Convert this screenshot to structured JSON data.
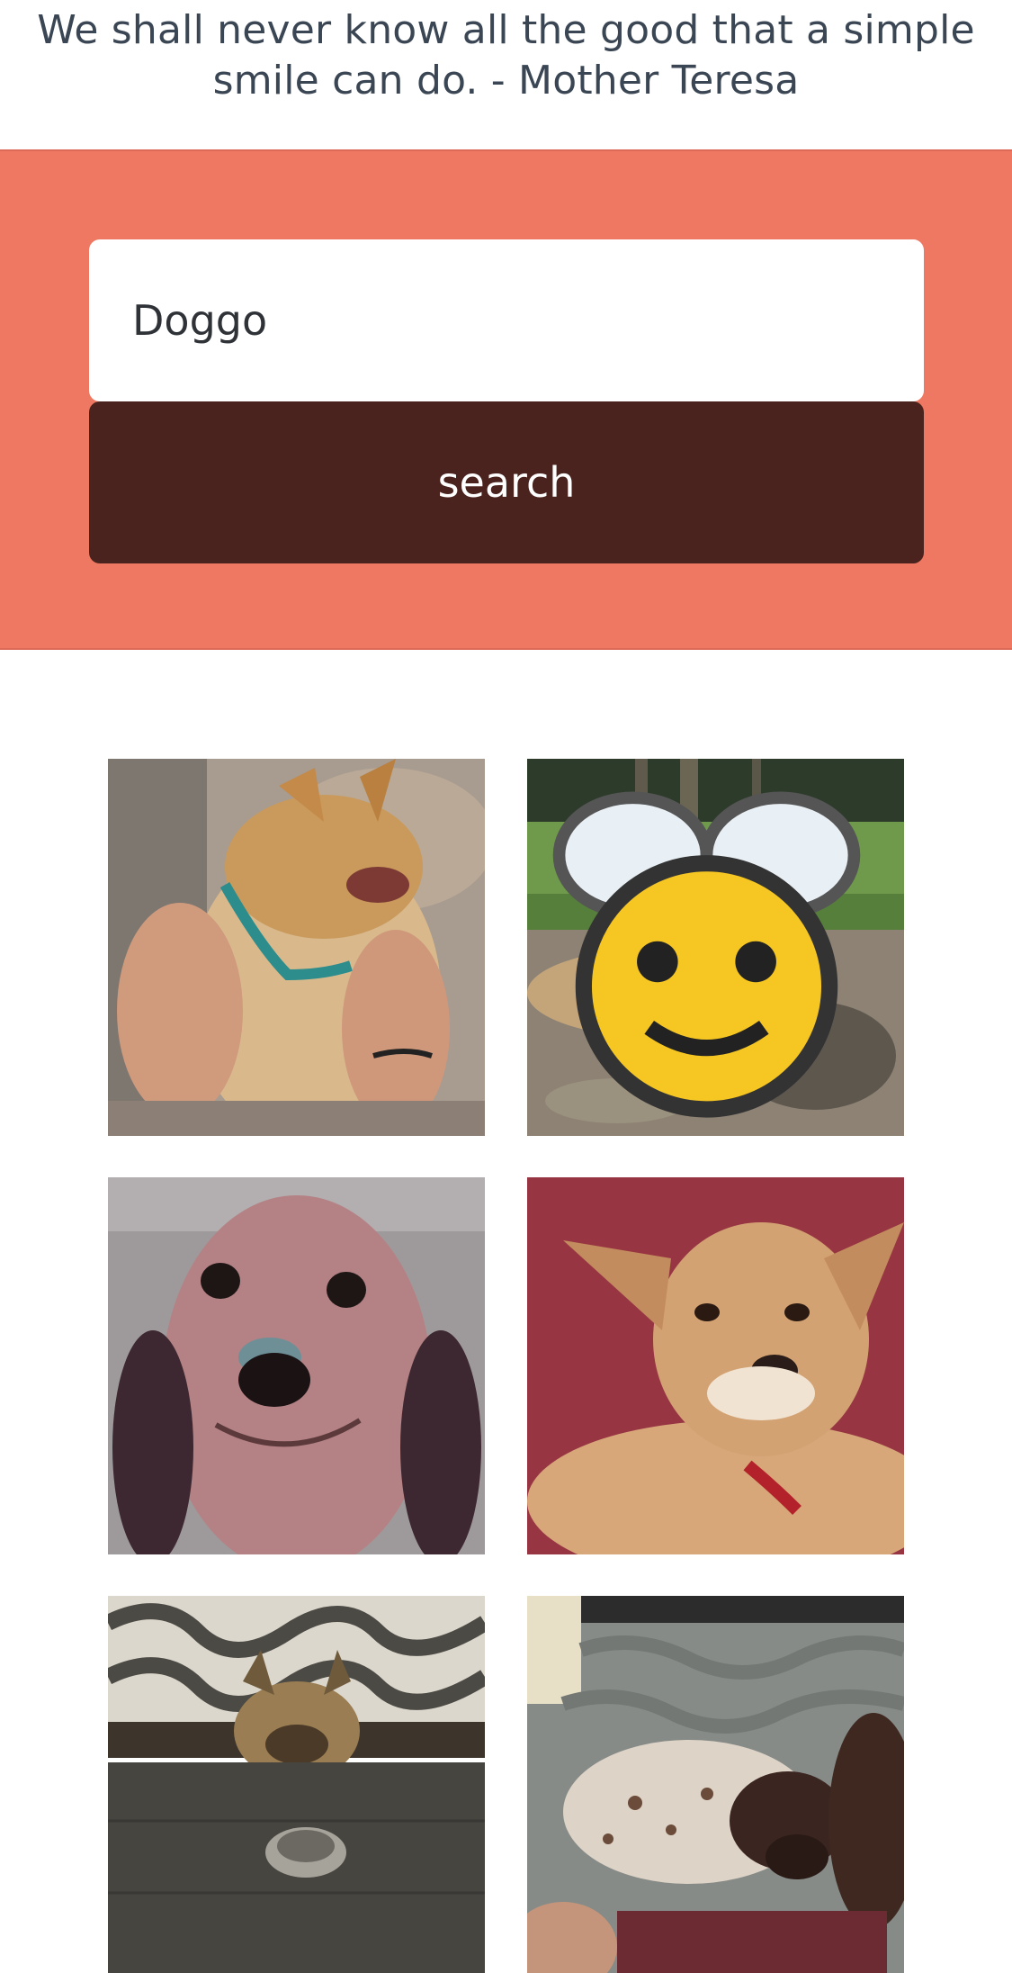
{
  "quote": {
    "text": "We shall never know all the good that a simple smile can do. - Mother Teresa"
  },
  "search": {
    "value": "Doggo",
    "button_label": "search"
  },
  "colors": {
    "banner": "#ee7862",
    "button": "#4a231e",
    "quote_text": "#3b4654"
  },
  "results": [
    {
      "description": "golden puppy with teal harness on its back being tickled",
      "icon": "dog-gif"
    },
    {
      "description": "dog rolling in mud puddle in a park",
      "icon": "dog-gif",
      "badge_icon": "bee-icon"
    },
    {
      "description": "smiling dachshund close-up",
      "icon": "dog-gif"
    },
    {
      "description": "chihuahua mix with red collar on red background",
      "icon": "dog-gif"
    },
    {
      "description": "french bulldog peeking over table at metal bowl",
      "icon": "dog-gif"
    },
    {
      "description": "spotted puppy lying on grey blanket",
      "icon": "dog-gif"
    }
  ]
}
